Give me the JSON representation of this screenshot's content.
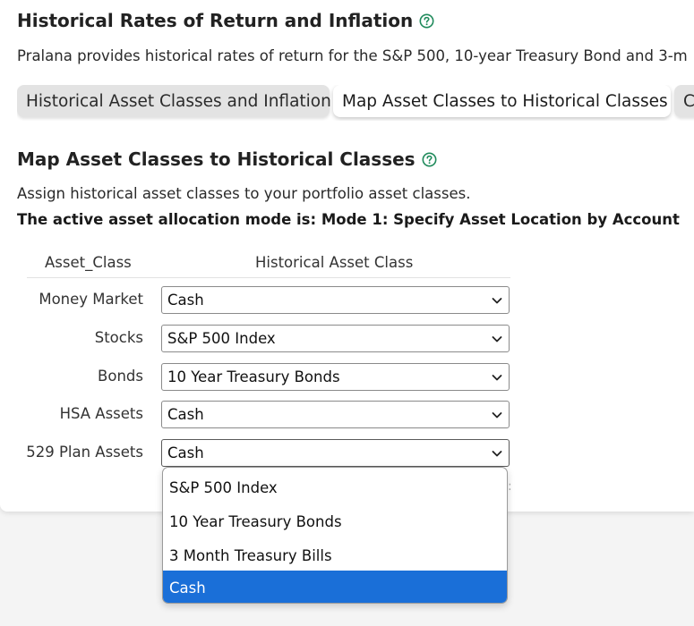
{
  "header": {
    "title": "Historical Rates of Return and Inflation",
    "description": "Pralana provides historical rates of return for the S&P 500, 10-year Treasury Bond and 3-m"
  },
  "tabs": [
    {
      "label": "Historical Asset Classes and Inflation",
      "active": false
    },
    {
      "label": "Map Asset Classes to Historical Classes",
      "active": true
    },
    {
      "label": "C",
      "active": false
    }
  ],
  "section": {
    "title": "Map Asset Classes to Historical Classes",
    "assign_text": "Assign historical asset classes to your portfolio asset classes.",
    "mode_text": "The active asset allocation mode is: Mode 1: Specify Asset Location by Account"
  },
  "table": {
    "col_asset_class": "Asset_Class",
    "col_historical": "Historical Asset Class",
    "rows": [
      {
        "label": "Money Market",
        "value": "Cash"
      },
      {
        "label": "Stocks",
        "value": "S&P 500 Index"
      },
      {
        "label": "Bonds",
        "value": "10 Year Treasury Bonds"
      },
      {
        "label": "HSA Assets",
        "value": "Cash"
      },
      {
        "label": "529 Plan Assets",
        "value": "Cash"
      }
    ]
  },
  "dropdown": {
    "options": [
      "S&P 500 Index",
      "10 Year Treasury Bonds",
      "3 Month Treasury Bills",
      "Cash"
    ],
    "selected": "Cash"
  },
  "colors": {
    "accent_green": "#1f8a5b",
    "selected_blue": "#1a6fd8"
  },
  "icons": {
    "help": "question-circle-icon",
    "chevron": "chevron-down-icon"
  }
}
